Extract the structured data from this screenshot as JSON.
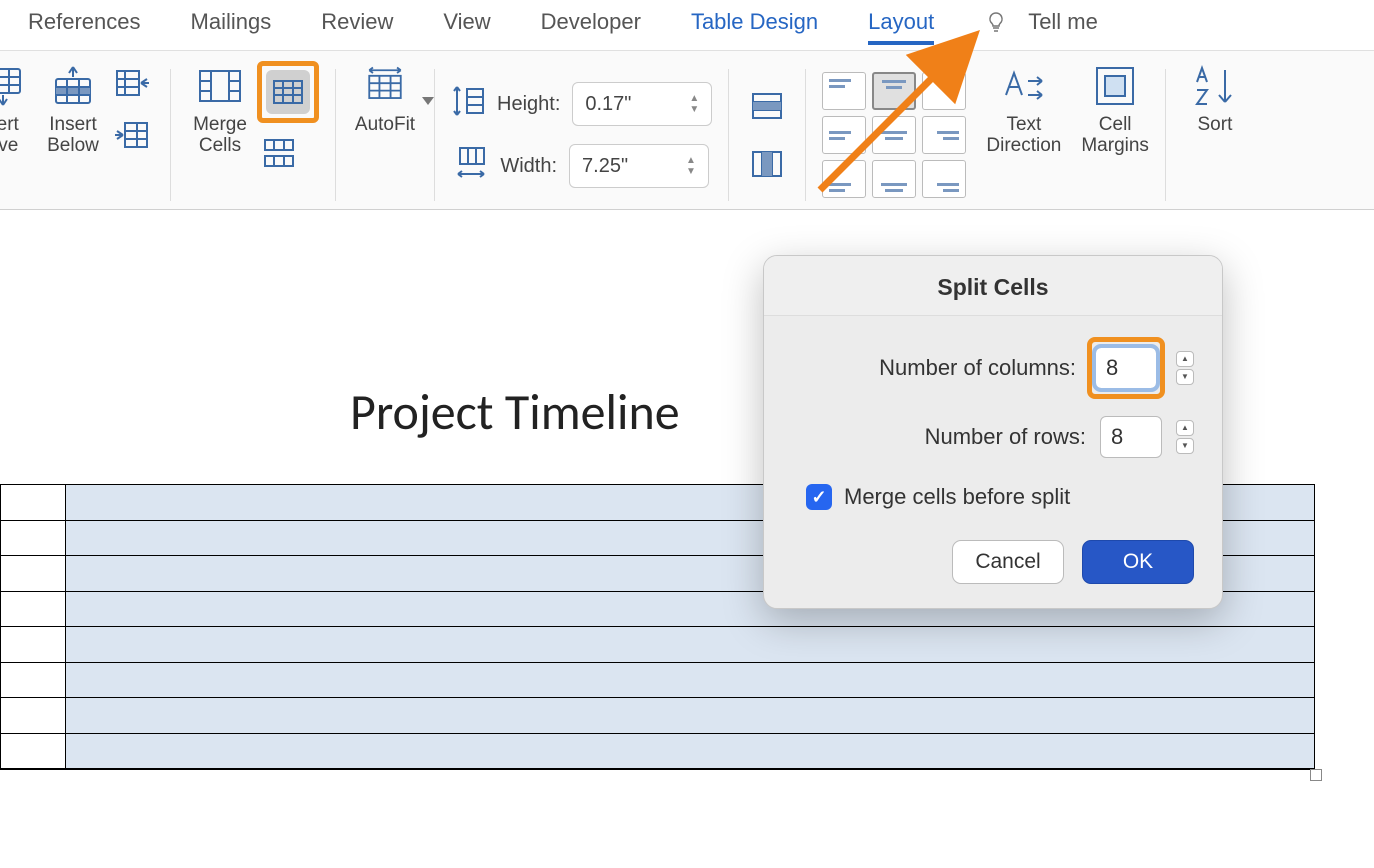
{
  "ribbon": {
    "tabs": [
      "References",
      "Mailings",
      "Review",
      "View",
      "Developer",
      "Table Design",
      "Layout"
    ],
    "active": "Layout",
    "accent": "Table Design",
    "tell_me": "Tell me"
  },
  "toolbar": {
    "insert_above": "sert\nove",
    "insert_below": "Insert\nBelow",
    "merge_cells": "Merge\nCells",
    "autofit": "AutoFit",
    "height_label": "Height:",
    "height_value": "0.17\"",
    "width_label": "Width:",
    "width_value": "7.25\"",
    "text_direction": "Text\nDirection",
    "cell_margins": "Cell\nMargins",
    "sort": "Sort"
  },
  "document": {
    "title": "Project Timeline",
    "rows": 8
  },
  "dialog": {
    "title": "Split Cells",
    "columns_label": "Number of columns:",
    "columns_value": "8",
    "rows_label": "Number of rows:",
    "rows_value": "8",
    "merge_label": "Merge cells before split",
    "merge_checked": true,
    "cancel": "Cancel",
    "ok": "OK"
  }
}
